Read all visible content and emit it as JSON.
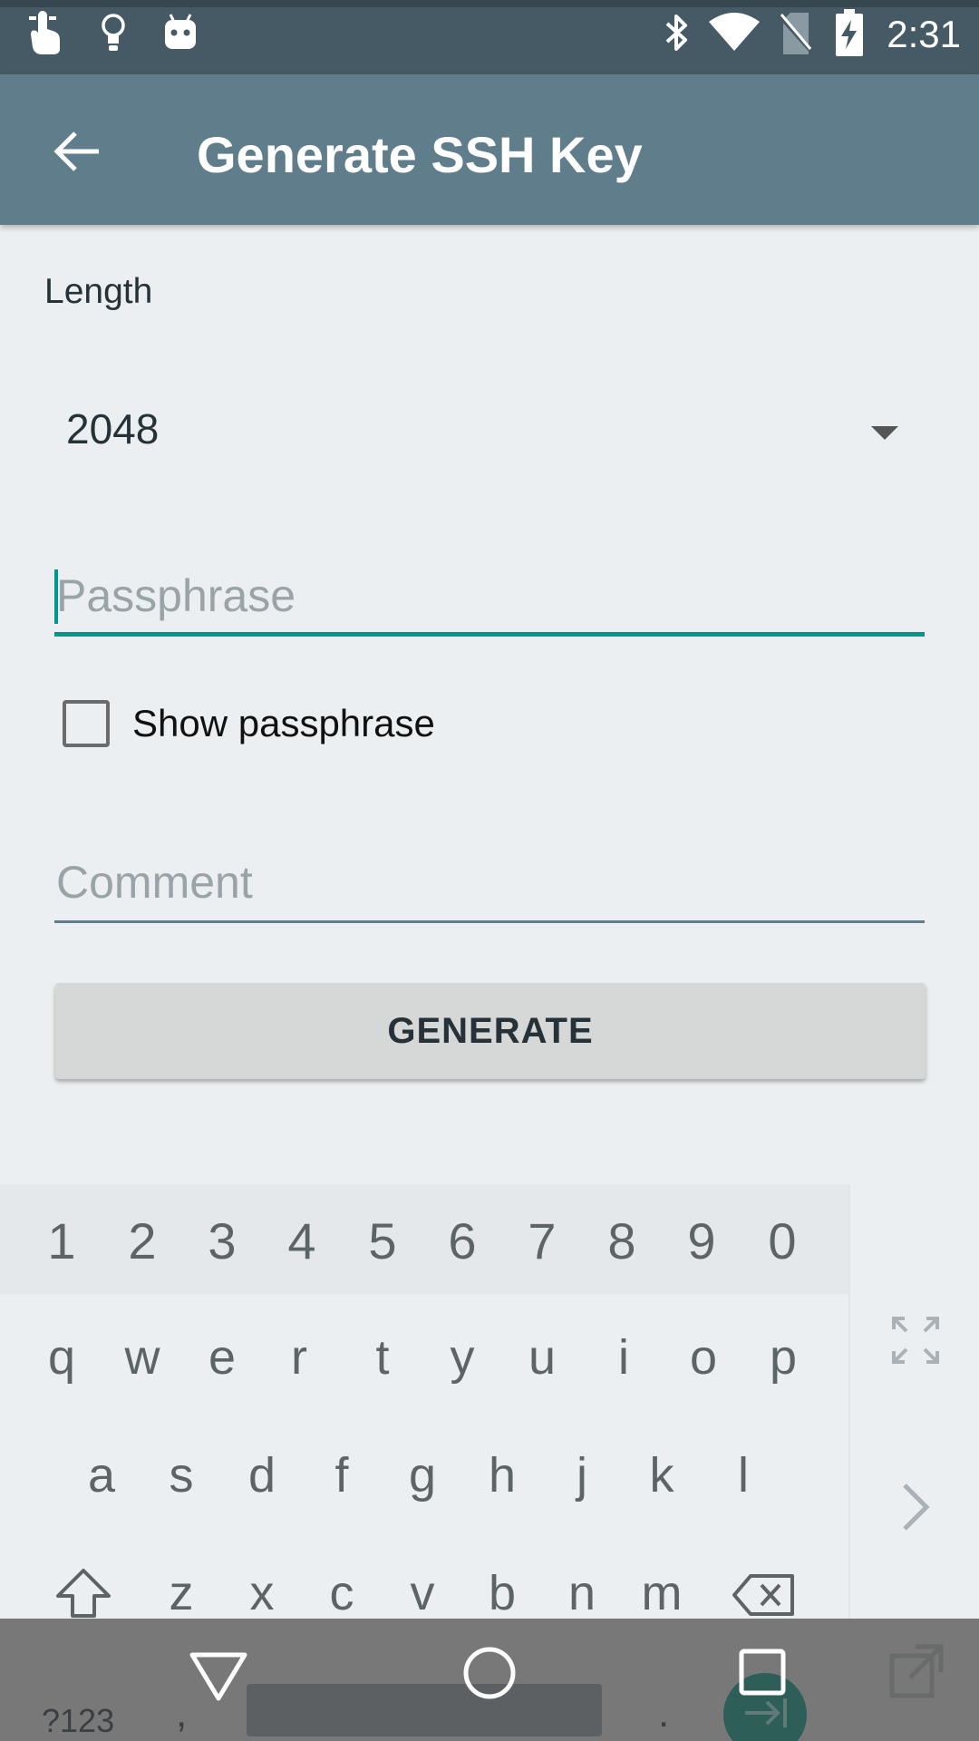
{
  "status_bar": {
    "time": "2:31",
    "left_icons": [
      "touch-icon",
      "lightbulb-icon",
      "android-icon"
    ],
    "right_icons": [
      "bluetooth-icon",
      "wifi-icon",
      "no-sim-icon",
      "battery-charging-icon"
    ]
  },
  "app_bar": {
    "title": "Generate SSH Key",
    "back_icon": "arrow-back-icon"
  },
  "form": {
    "length_label": "Length",
    "length_value": "2048",
    "passphrase_placeholder": "Passphrase",
    "show_passphrase_label": "Show passphrase",
    "show_passphrase_checked": false,
    "comment_placeholder": "Comment",
    "generate_label": "GENERATE"
  },
  "keyboard": {
    "numbers": [
      "1",
      "2",
      "3",
      "4",
      "5",
      "6",
      "7",
      "8",
      "9",
      "0"
    ],
    "row1": [
      "q",
      "w",
      "e",
      "r",
      "t",
      "y",
      "u",
      "i",
      "o",
      "p"
    ],
    "row2": [
      "a",
      "s",
      "d",
      "f",
      "g",
      "h",
      "j",
      "k",
      "l"
    ],
    "row3": [
      "z",
      "x",
      "c",
      "v",
      "b",
      "n",
      "m"
    ],
    "symbols_key": "?123",
    "comma_key": ",",
    "period_key": "."
  },
  "colors": {
    "status_bar": "#455a64",
    "app_bar": "#607d8b",
    "accent": "#00968a",
    "background": "#eceff1"
  }
}
